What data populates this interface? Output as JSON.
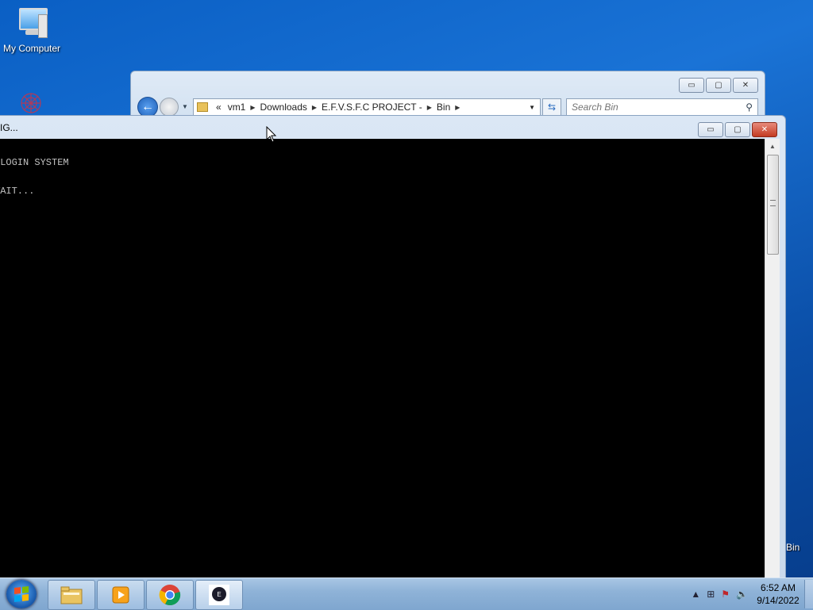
{
  "desktop": {
    "icons": [
      {
        "label": "My Computer"
      }
    ],
    "peek_label": "Bin"
  },
  "explorer": {
    "breadcrumb": {
      "overflow": "«",
      "items": [
        "vm1",
        "Downloads",
        "E.F.V.S.F.C PROJECT -",
        "Bin"
      ]
    },
    "search_placeholder": "Search Bin",
    "controls": {
      "minimize": "▭",
      "maximize": "▢",
      "close": "✕"
    }
  },
  "console": {
    "title": "IG...",
    "lines": [
      " LOGIN SYSTEM",
      "WAIT..."
    ],
    "controls": {
      "minimize": "▭",
      "maximize": "▢",
      "close": "✕"
    }
  },
  "taskbar": {
    "buttons": [
      {
        "name": "file-explorer",
        "icon": "folder-icon"
      },
      {
        "name": "media-player",
        "icon": "media-player-icon"
      },
      {
        "name": "chrome",
        "icon": "chrome-icon"
      },
      {
        "name": "console-app",
        "icon": "app-icon",
        "active": true
      }
    ],
    "clock": {
      "time": "6:52 AM",
      "date": "9/14/2022"
    },
    "tray": {
      "expand": "▲",
      "network": "⊞",
      "flag": "⚑",
      "volume": "🔈"
    }
  }
}
